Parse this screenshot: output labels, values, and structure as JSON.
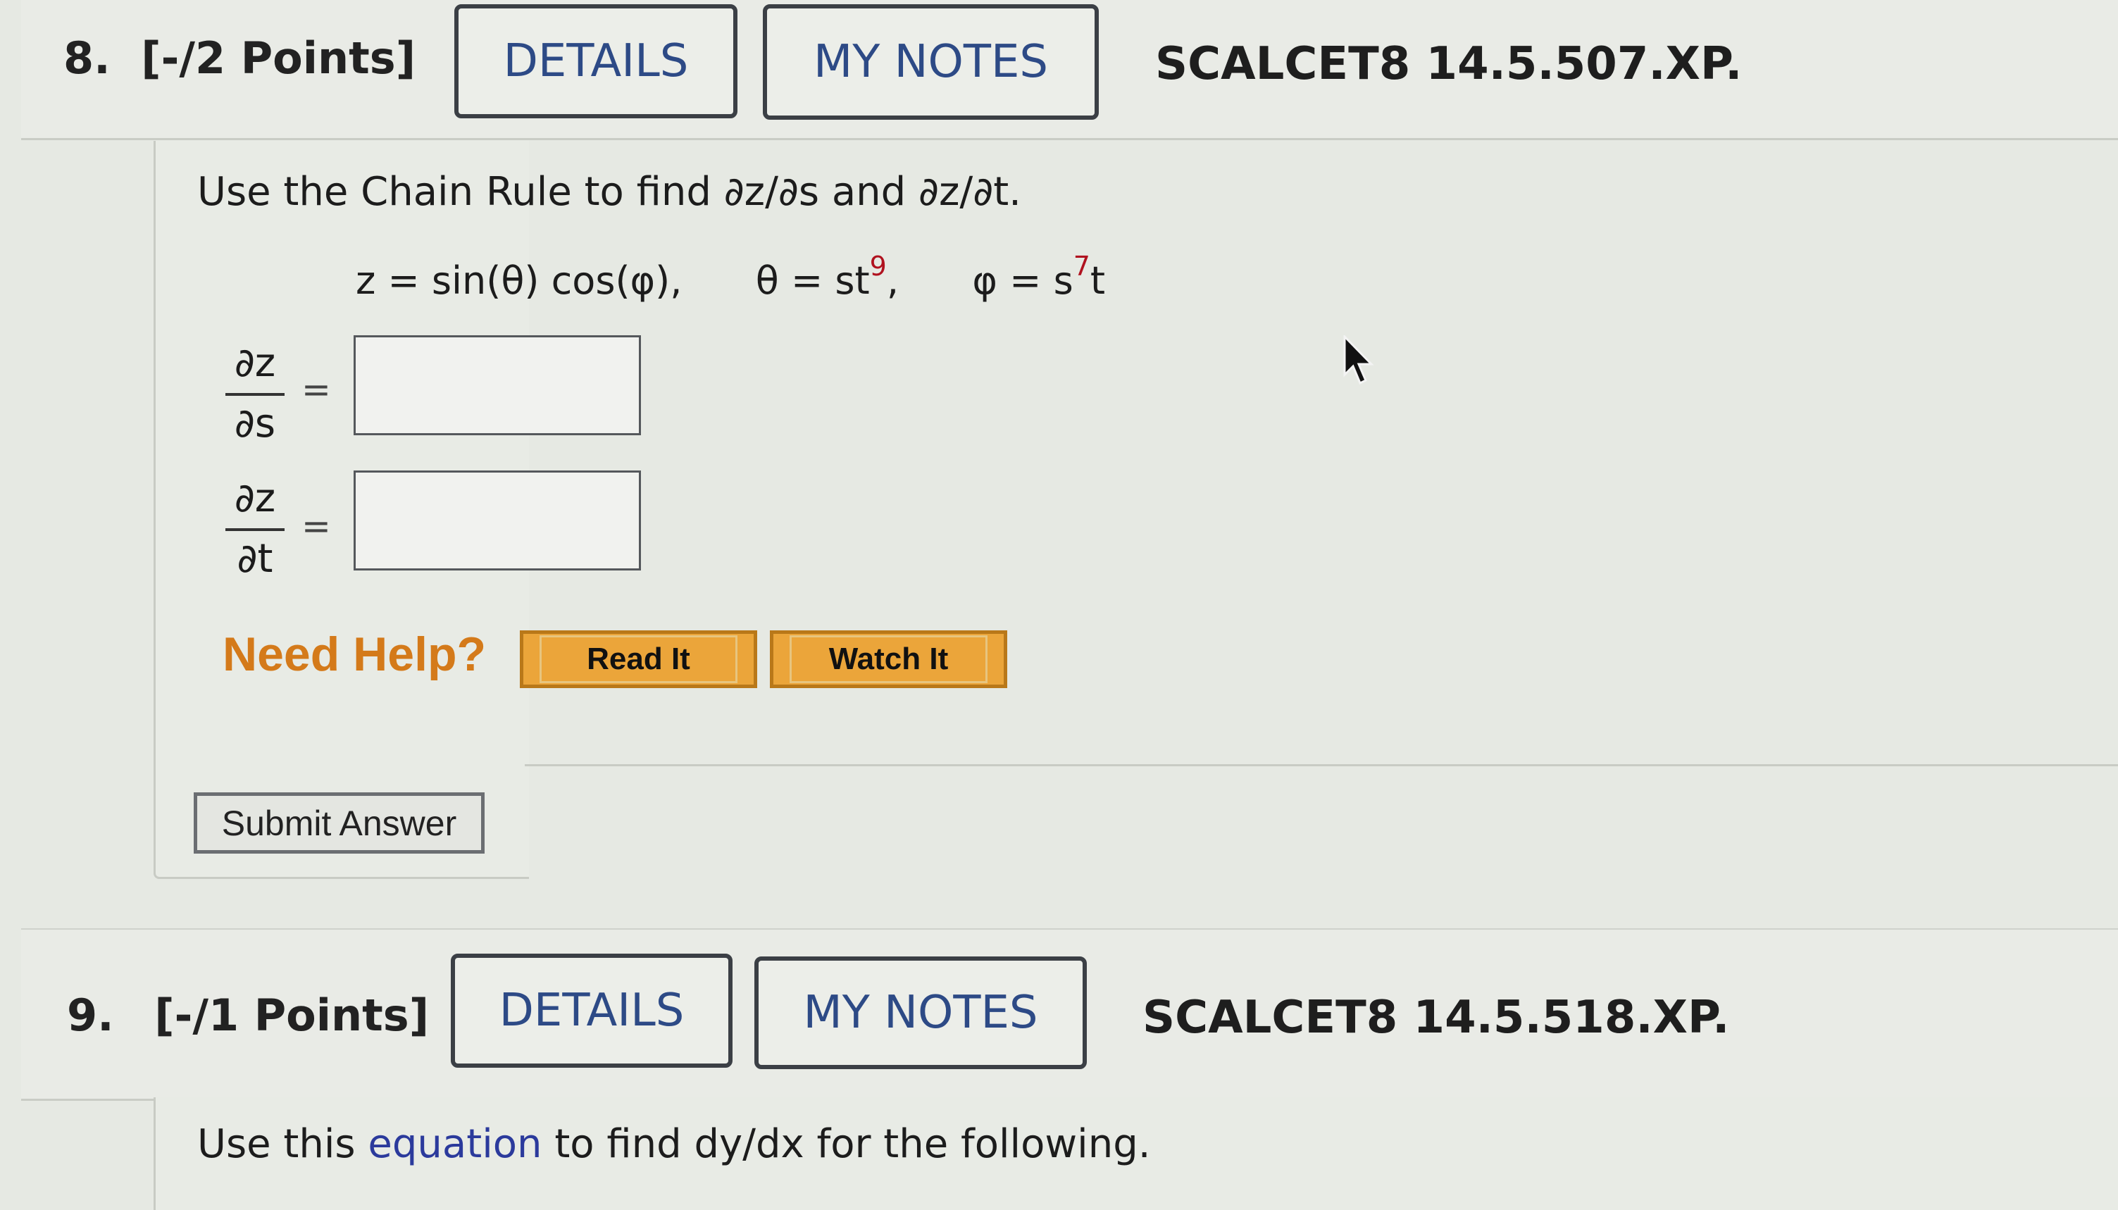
{
  "q8": {
    "number": "8.",
    "points": "[-/2 Points]",
    "details_label": "DETAILS",
    "notes_label": "MY NOTES",
    "code": "SCALCET8 14.5.507.XP.",
    "prompt": "Use the Chain Rule to find ∂z/∂s and ∂z/∂t.",
    "equation": {
      "z_part": "z = sin(θ) cos(φ),",
      "theta_lhs": "θ = st",
      "theta_exp": "9",
      "theta_tail": ",",
      "phi_lhs": "φ = s",
      "phi_exp": "7",
      "phi_tail": "t"
    },
    "answer1": {
      "num": "∂z",
      "den": "∂s",
      "equals": "="
    },
    "answer2": {
      "num": "∂z",
      "den": "∂t",
      "equals": "="
    },
    "need_help": "Need Help?",
    "read_it": "Read It",
    "watch_it": "Watch It",
    "submit": "Submit Answer"
  },
  "q9": {
    "number": "9.",
    "points": "[-/1 Points]",
    "details_label": "DETAILS",
    "notes_label": "MY NOTES",
    "code": "SCALCET8 14.5.518.XP.",
    "prompt_pre": "Use this",
    "prompt_link": "equation",
    "prompt_post": "to find dy/dx for the following."
  },
  "icons": [
    "mouse-pointer-icon"
  ]
}
